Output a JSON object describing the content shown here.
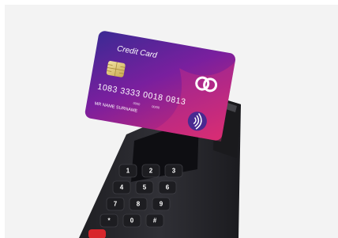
{
  "card": {
    "title": "Credit Card",
    "number": "1083 3333 0018 0813",
    "holder_name": "MR  NAME  SURNAME",
    "small_text_left": "0000",
    "small_text_right": "00/00",
    "colors": {
      "start": "#3b2a94",
      "middle": "#7a1f9e",
      "end": "#d62a6e",
      "logo": "#ffffff",
      "chip": "#e2cf8a"
    }
  },
  "terminal": {
    "body_color": "#2a2a2e",
    "screen_color": "#0e0e12",
    "keypad": [
      [
        "1",
        "2",
        "3"
      ],
      [
        "4",
        "5",
        "6"
      ],
      [
        "7",
        "8",
        "9"
      ],
      [
        "*",
        "0",
        "#"
      ]
    ],
    "accent_key_color": "#d8262c"
  },
  "background": {
    "color": "#f3f3f3"
  }
}
